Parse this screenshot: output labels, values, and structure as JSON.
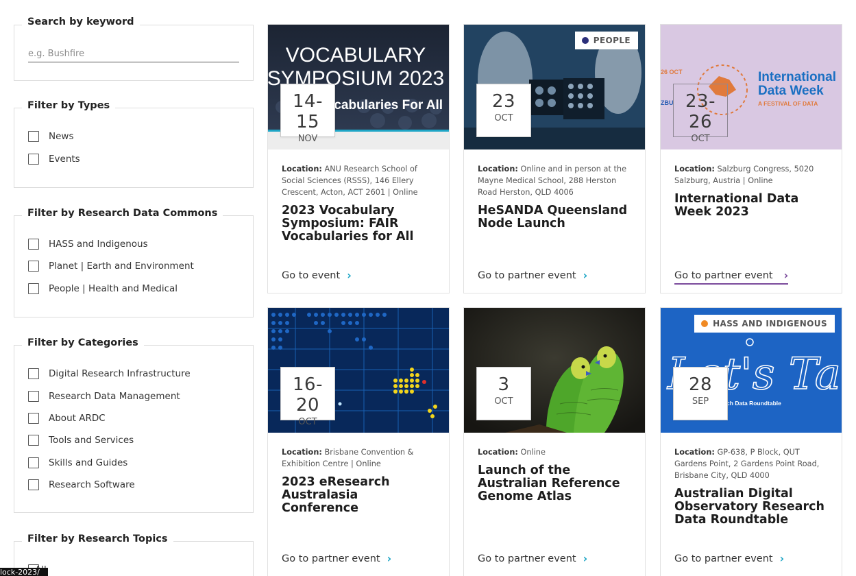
{
  "sidebar": {
    "search": {
      "title": "Search by keyword",
      "placeholder": "e.g. Bushfire"
    },
    "types": {
      "title": "Filter by Types",
      "options": [
        "News",
        "Events"
      ]
    },
    "commons": {
      "title": "Filter by Research Data Commons",
      "options": [
        "HASS and Indigenous",
        "Planet | Earth and Environment",
        "People | Health and Medical"
      ]
    },
    "categories": {
      "title": "Filter by Categories",
      "options": [
        "Digital Research Infrastructure",
        "Research Data Management",
        "About ARDC",
        "Tools and Services",
        "Skills and Guides",
        "Research Software"
      ]
    },
    "topics": {
      "title": "Filter by Research Topics",
      "options": [
        "All"
      ]
    }
  },
  "tooltip": "lock-2023/",
  "location_label": "Location:",
  "cards": [
    {
      "date_day": "14-15",
      "date_month": "NOV",
      "image_text": {
        "line1": "VOCABULARY",
        "line2": "SYMPOSIUM 2023",
        "line3": "FAIR Vocabularies For All"
      },
      "location": "ANU Research School of Social Sciences (RSSS), 146 Ellery Crescent, Acton, ACT 2601 | Online",
      "title": "2023 Vocabulary Symposium: FAIR Vocabularies for All",
      "link": "Go to event"
    },
    {
      "date_day": "23",
      "date_month": "OCT",
      "badge": {
        "label": "PEOPLE",
        "color": "#2b2f7a"
      },
      "location": "Online and in person at the Mayne Medical School, 288 Herston Road Herston, QLD 4006",
      "title": "HeSANDA Queensland Node Launch",
      "link": "Go to partner event"
    },
    {
      "date_day": "23-26",
      "date_month": "OCT",
      "image_text": {
        "line1": "International",
        "line2": "Data Week",
        "line3": "A FESTIVAL OF DATA",
        "line4": "26 OCT",
        "line5": "ZBU"
      },
      "location": "Salzburg Congress, 5020 Salzburg, Austria | Online",
      "title": "International Data Week 2023",
      "link": "Go to partner event"
    },
    {
      "date_day": "16-20",
      "date_month": "OCT",
      "location": "Brisbane Convention & Exhibition Centre | Online",
      "title": "2023 eResearch Australasia Conference",
      "link": "Go to partner event"
    },
    {
      "date_day": "3",
      "date_month": "OCT",
      "location": "Online",
      "title": "Launch of the Australian Reference Genome Atlas",
      "link": "Go to partner event"
    },
    {
      "date_day": "28",
      "date_month": "SEP",
      "badge": {
        "label": "HASS AND INDIGENOUS",
        "color": "#f08a24"
      },
      "image_text": {
        "line1": "Let's Talk",
        "line2": "arch Data Roundtable"
      },
      "location": "GP-638, P Block, QUT Gardens Point, 2 Gardens Point Road, Brisbane City, QLD 4000",
      "title": "Australian Digital Observatory Research Data Roundtable",
      "link": "Go to partner event"
    }
  ],
  "colors": {
    "chevron": "#1fa6c6",
    "chevron_alt": "#7b4b9c",
    "card_border": "#e1e1e1"
  }
}
